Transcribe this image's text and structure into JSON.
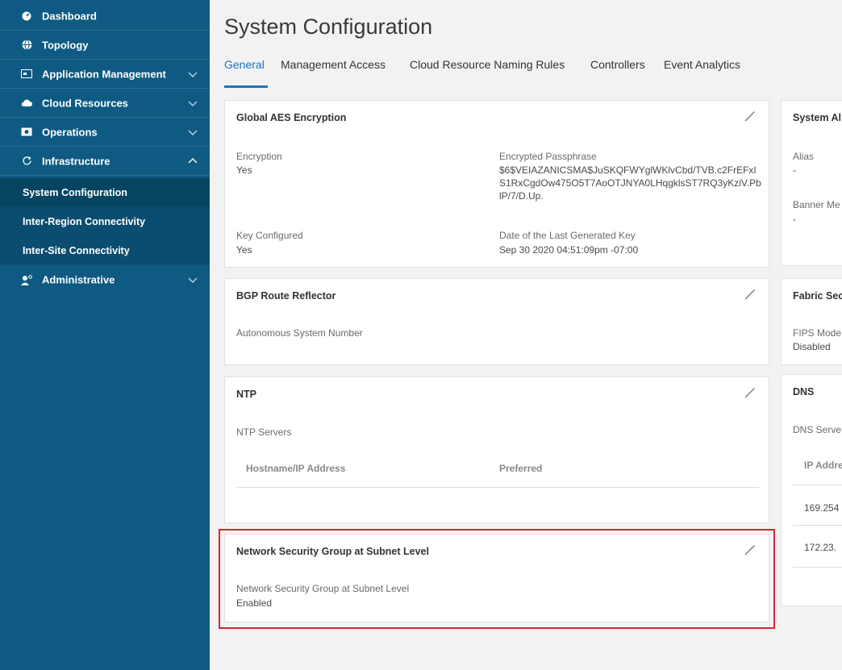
{
  "sidebar": {
    "items": [
      {
        "label": "Dashboard",
        "icon": "dashboard-icon"
      },
      {
        "label": "Topology",
        "icon": "globe-icon"
      },
      {
        "label": "Application Management",
        "icon": "window-icon"
      },
      {
        "label": "Cloud Resources",
        "icon": "cloud-icon"
      },
      {
        "label": "Operations",
        "icon": "gear-icon"
      },
      {
        "label": "Infrastructure",
        "icon": "refresh-icon"
      },
      {
        "label": "Administrative",
        "icon": "admin-user-icon"
      }
    ],
    "infrastructure_subitems": [
      {
        "label": "System Configuration"
      },
      {
        "label": "Inter-Region Connectivity"
      },
      {
        "label": "Inter-Site Connectivity"
      }
    ]
  },
  "page": {
    "title": "System Configuration",
    "tabs": [
      "General",
      "Management Access",
      "Cloud Resource Naming Rules",
      "Controllers",
      "Event Analytics"
    ],
    "active_tab": "General"
  },
  "cards": {
    "aes": {
      "title": "Global AES Encryption",
      "encryption_label": "Encryption",
      "encryption_value": "Yes",
      "passphrase_label": "Encrypted Passphrase",
      "passphrase_value": "$6$VEIAZANICSMA$JuSKQFWYglWKlvCbd/TVB.c2FrEFxIS1RxCgdOw475O5T7AoOTJNYA0LHqgklsST7RQ3yKziV.PblP/7/D.Up.",
      "key_configured_label": "Key Configured",
      "key_configured_value": "Yes",
      "last_key_label": "Date of the Last Generated Key",
      "last_key_value": "Sep 30 2020 04:51:09pm -07:00"
    },
    "bgp": {
      "title": "BGP Route Reflector",
      "asn_label": "Autonomous System Number"
    },
    "ntp": {
      "title": "NTP",
      "servers_label": "NTP Servers",
      "col_host": "Hostname/IP Address",
      "col_pref": "Preferred"
    },
    "nsg": {
      "title": "Network Security Group at Subnet Level",
      "field_label": "Network Security Group at Subnet Level",
      "field_value": "Enabled"
    },
    "system_alias": {
      "title": "System Al",
      "alias_label": "Alias",
      "alias_value": "-",
      "banner_label": "Banner Me",
      "banner_value": "-"
    },
    "fabric": {
      "title": "Fabric Sec",
      "fips_label": "FIPS Mode",
      "fips_value": "Disabled"
    },
    "dns": {
      "title": "DNS",
      "servers_label": "DNS Serve",
      "col_ip": "IP Addre",
      "rows": [
        "169.254",
        "172.23."
      ]
    }
  },
  "colors": {
    "sidebar": "#0e5a82",
    "accent": "#1a73c9",
    "highlight": "#d9262e"
  }
}
